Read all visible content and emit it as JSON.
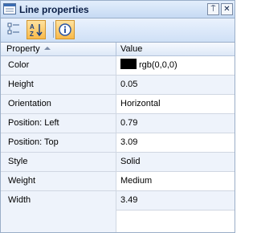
{
  "panel": {
    "title": "Line properties",
    "pin_glyph": "⍑",
    "close_glyph": "✕"
  },
  "toolbar": {
    "buttons": [
      {
        "name": "categorized-view",
        "icon": "categorized-icon",
        "active": false
      },
      {
        "name": "alphabetical-sort",
        "icon": "sort-az-icon",
        "active": true
      },
      {
        "name": "property-info",
        "icon": "info-icon",
        "active": true
      }
    ]
  },
  "grid": {
    "header_property": "Property",
    "header_value": "Value",
    "rows": [
      {
        "property": "Color",
        "value": "rgb(0,0,0)",
        "swatch": "#000000"
      },
      {
        "property": "Height",
        "value": "0.05"
      },
      {
        "property": "Orientation",
        "value": "Horizontal"
      },
      {
        "property": "Position: Left",
        "value": "0.79"
      },
      {
        "property": "Position: Top",
        "value": "3.09"
      },
      {
        "property": "Style",
        "value": "Solid"
      },
      {
        "property": "Weight",
        "value": "Medium"
      },
      {
        "property": "Width",
        "value": "3.49"
      }
    ]
  }
}
